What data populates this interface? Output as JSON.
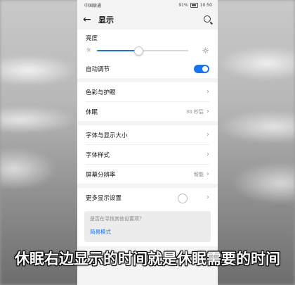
{
  "statusbar": {
    "carrier": "中国联通 ",
    "battery": "91%",
    "time": "10:50"
  },
  "appbar": {
    "title": "显示"
  },
  "brightness": {
    "title": "亮度",
    "level": 0.45,
    "auto_label": "自动调节",
    "auto_on": true
  },
  "items": [
    {
      "label": "色彩与护眼",
      "value": ""
    },
    {
      "label": "休眠",
      "value": "30 秒后"
    },
    {
      "label": "字体与显示大小",
      "value": ""
    },
    {
      "label": "字体样式",
      "value": ""
    },
    {
      "label": "屏幕分辨率",
      "value": "智能"
    },
    {
      "label": "更多显示设置",
      "value": ""
    }
  ],
  "hint": {
    "question": "是否在寻找其他设置项？",
    "link": "简易模式"
  },
  "caption": "休眠右边显示的时间就是休眠需要的时间",
  "colors": {
    "accent": "#1a73e8"
  }
}
